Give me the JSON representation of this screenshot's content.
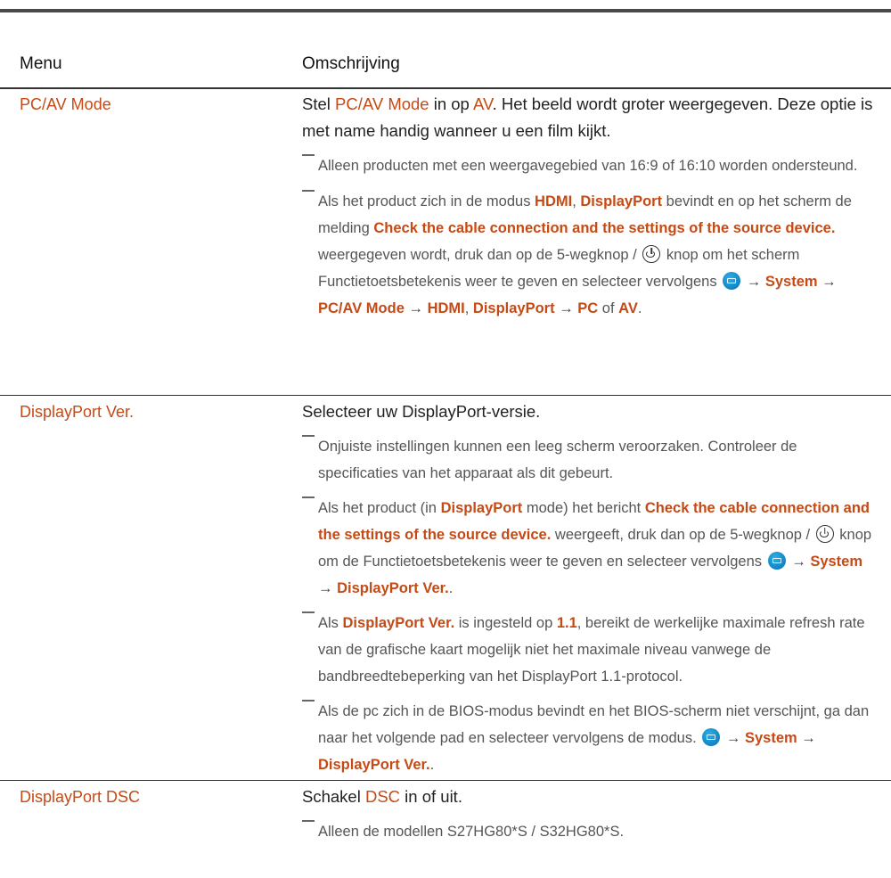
{
  "table": {
    "header": {
      "menu": "Menu",
      "description": "Omschrijving"
    },
    "rows": [
      {
        "menu": "PC/AV Mode",
        "main": {
          "p1": "Stel ",
          "h1": "PC/AV Mode",
          "p2": " in op ",
          "h2": "AV",
          "p3": ". Het beeld wordt groter weergegeven. Deze optie is met name handig wanneer u een film kijkt."
        },
        "note1": "Alleen producten met een weergavegebied van 16:9 of 16:10 worden ondersteund.",
        "note2": {
          "p1": "Als het product zich in de modus ",
          "h1": "HDMI",
          "p2": ", ",
          "h2": "DisplayPort",
          "p3": " bevindt en op het scherm de melding ",
          "h3": "Check the cable connection and the settings of the source device.",
          "p4": " weergegeven wordt, druk dan op de 5-wegknop / ",
          "p5": " knop om het scherm Functietoetsbetekenis weer te geven en selecteer vervolgens ",
          "arrow": "→",
          "h4": "System",
          "h5": "PC/AV Mode",
          "h6": "HDMI",
          "p6": ", ",
          "h7": "DisplayPort",
          "h8": "PC",
          "p7": " of ",
          "h9": "AV",
          "p8": "."
        }
      },
      {
        "menu": "DisplayPort Ver.",
        "main": "Selecteer uw DisplayPort-versie.",
        "note1": "Onjuiste instellingen kunnen een leeg scherm veroorzaken. Controleer de specificaties van het apparaat als dit gebeurt.",
        "note2": {
          "p1": "Als het product (in ",
          "h1": "DisplayPort",
          "p2": " mode) het bericht ",
          "h2": "Check the cable connection and the settings of the source device.",
          "p3": " weergeeft, druk dan op de 5-wegknop / ",
          "p4": " knop om de Functietoetsbetekenis weer te geven en selecteer vervolgens ",
          "arrow": "→",
          "h3": "System",
          "h4": "DisplayPort Ver.",
          "p5": "."
        },
        "note3": {
          "p1": "Als ",
          "h1": "DisplayPort Ver.",
          "p2": " is ingesteld op ",
          "h2": "1.1",
          "p3": ", bereikt de werkelijke maximale refresh rate van de grafische kaart mogelijk niet het maximale niveau vanwege de bandbreedtebeperking van het DisplayPort 1.1-protocol."
        },
        "note4": {
          "p1": "Als de pc zich in de BIOS-modus bevindt en het BIOS-scherm niet verschijnt, ga dan naar het volgende pad en selecteer vervolgens de modus. ",
          "arrow": "→",
          "h1": "System",
          "h2": "DisplayPort Ver.",
          "p2": "."
        }
      },
      {
        "menu": "DisplayPort DSC",
        "main": {
          "p1": "Schakel ",
          "h1": "DSC",
          "p2": " in of uit."
        },
        "note1": "Alleen de modellen S27HG80*S / S32HG80*S."
      }
    ]
  },
  "icons": {
    "power": "power-icon",
    "menu": "menu-icon"
  },
  "colors": {
    "accent": "#c44a16",
    "rule": "#333333"
  }
}
